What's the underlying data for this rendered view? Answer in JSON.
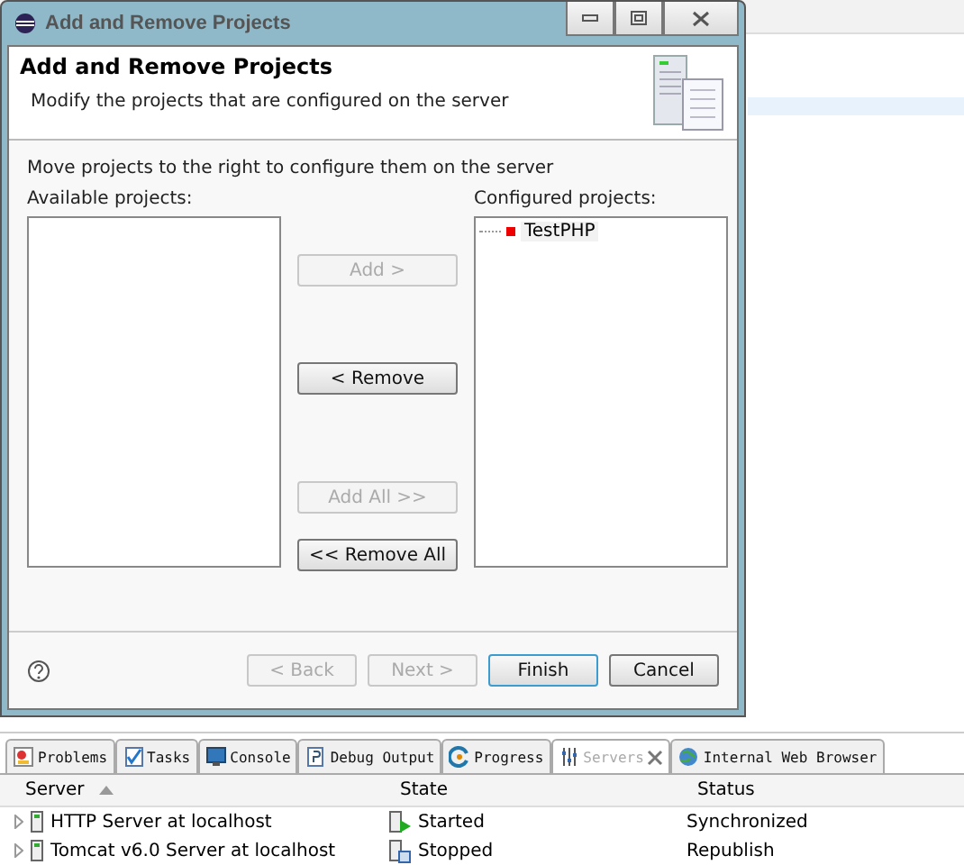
{
  "dialog": {
    "title": "Add and Remove Projects",
    "heading": "Add and Remove Projects",
    "description": "Modify the projects that are configured on the server",
    "instruction": "Move projects to the right to configure them on the server",
    "available": {
      "label": "Available projects:"
    },
    "configured": {
      "label": "Configured projects:",
      "items": [
        {
          "label": "TestPHP",
          "color": "#ee0000"
        }
      ]
    },
    "middle_buttons": [
      {
        "label": "Add >",
        "disabled": true
      },
      {
        "label": "< Remove",
        "disabled": false
      },
      {
        "label": "Add All >>",
        "disabled": true
      },
      {
        "label": "<< Remove All",
        "disabled": false
      }
    ],
    "footer_buttons": [
      {
        "label": "< Back",
        "disabled": true,
        "default": false
      },
      {
        "label": "Next >",
        "disabled": true,
        "default": false
      },
      {
        "label": "Finish",
        "disabled": false,
        "default": true
      },
      {
        "label": "Cancel",
        "disabled": false,
        "default": false
      }
    ]
  },
  "panel": {
    "tabs": [
      {
        "label": "Problems",
        "selected": false
      },
      {
        "label": "Tasks",
        "selected": false
      },
      {
        "label": "Console",
        "selected": false
      },
      {
        "label": "Debug Output",
        "selected": false
      },
      {
        "label": "Progress",
        "selected": false
      },
      {
        "label": "Servers",
        "selected": true
      },
      {
        "label": "Internal Web Browser",
        "selected": false
      }
    ],
    "columns": [
      "Server",
      "State",
      "Status"
    ],
    "rows": [
      {
        "server": "HTTP Server at localhost",
        "state": "Started",
        "kind": "started",
        "status": "Synchronized"
      },
      {
        "server": "Tomcat v6.0 Server at localhost",
        "state": "Stopped",
        "kind": "stopped",
        "status": "Republish"
      }
    ]
  }
}
